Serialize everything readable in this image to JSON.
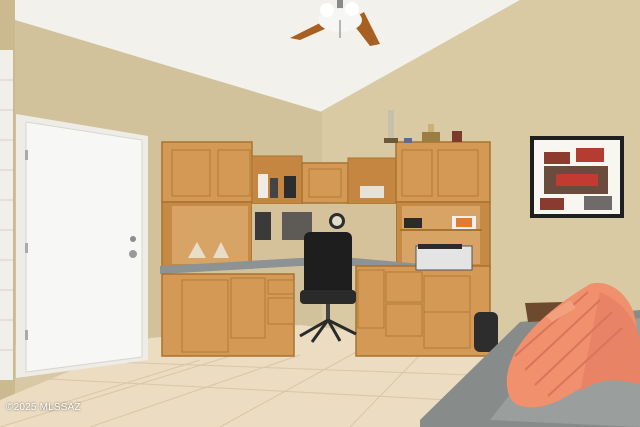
{
  "watermark": "©2025 MLSSAZ",
  "scene": {
    "wall_color": "#d6c69f",
    "ceiling_color": "#f2f0ec",
    "floor_color": "#ebdcc2",
    "cabinet_color": "#d49a55",
    "counter_color": "#8c9192",
    "door_color": "#f4f4f2",
    "pillow_color": "#f0906c",
    "sofa_color": "#8a8d8c"
  }
}
